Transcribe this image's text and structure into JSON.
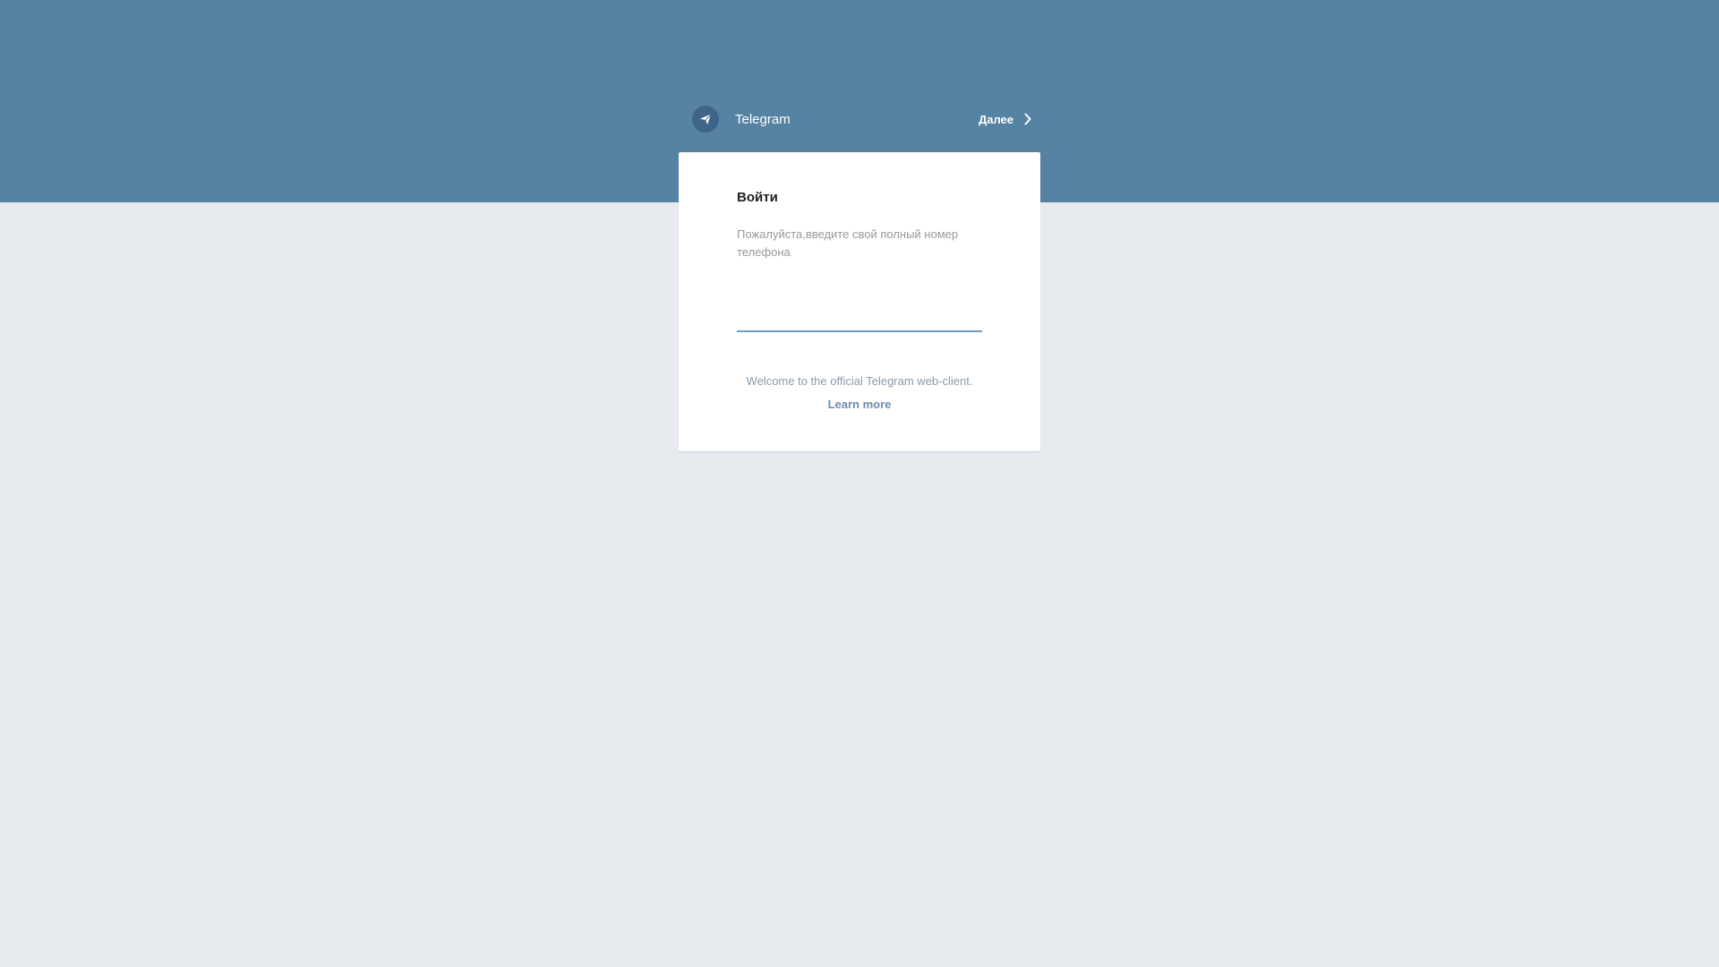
{
  "header": {
    "brand_name": "Telegram",
    "next_label": "Далее"
  },
  "login": {
    "title": "Войти",
    "description": "Пожалуйста,введите свой полный номер телефона",
    "phone_value": "",
    "welcome_text": "Welcome to the official Telegram web-client.",
    "learn_more_label": "Learn more"
  },
  "colors": {
    "top_band": "#5682a3",
    "page_background": "#e7ebf0",
    "input_underline": "#6a9ec8",
    "link": "#6d8fb0"
  },
  "icons": {
    "logo": "telegram-plane-icon",
    "next": "chevron-right-icon"
  }
}
